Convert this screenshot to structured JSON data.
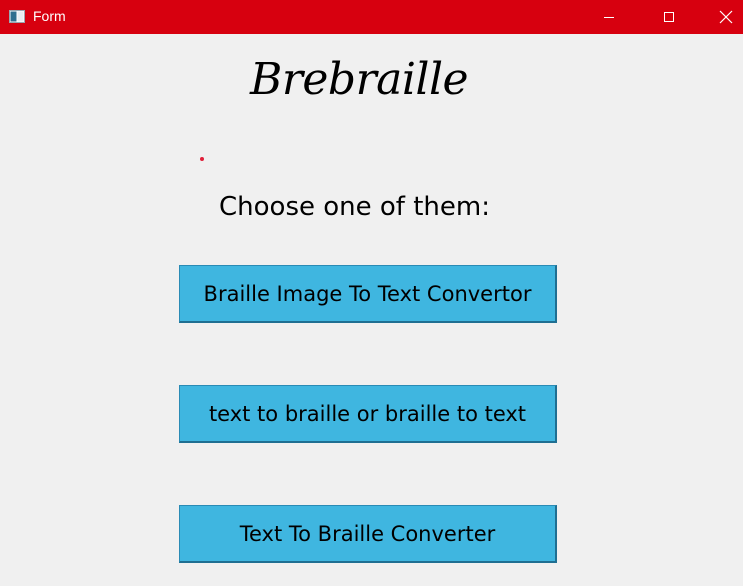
{
  "window": {
    "title": "Form",
    "title_bar_color": "#d7000f",
    "title_text_color": "#ffffff",
    "controls": {
      "minimize": "minimize-icon",
      "maximize": "maximize-icon",
      "close": "close-icon"
    }
  },
  "main": {
    "brand_title": "Brebraille",
    "dot_color": "#e0203a",
    "prompt": "Choose one of them:",
    "buttons": [
      {
        "label": "Braille Image To Text Convertor"
      },
      {
        "label": "text to braille or braille to text"
      },
      {
        "label": "Text To Braille Converter"
      }
    ],
    "button_color": "#3fb6e0"
  }
}
